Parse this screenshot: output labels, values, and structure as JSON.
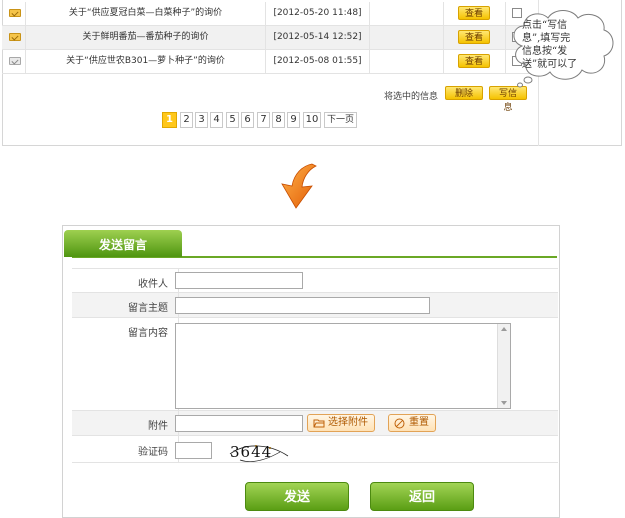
{
  "messages": [
    {
      "title": "关于“供应夏冠白菜—白菜种子”的询价",
      "date": "[2012-05-20 11:48]",
      "view": "查看",
      "icon": "envelope-closed"
    },
    {
      "title": "关于鲜明番茄—番茄种子的询价",
      "date": "[2012-05-14 12:52]",
      "view": "查看",
      "icon": "envelope-closed"
    },
    {
      "title": "关于“供应世农B301—萝卜种子”的询价",
      "date": "[2012-05-08 01:55]",
      "view": "查看",
      "icon": "envelope-open"
    }
  ],
  "actions": {
    "selected_label": "将选中的信息",
    "delete": "删除",
    "write": "写信息"
  },
  "pagination": {
    "pages": [
      "1",
      "2",
      "3",
      "4",
      "5",
      "6",
      "7",
      "8",
      "9",
      "10"
    ],
    "current": "1",
    "next": "下一页"
  },
  "callout": {
    "line1": "点击“写信",
    "line2": "息”,填写完",
    "line3": "信息按“发",
    "line4": "送”就可以了"
  },
  "form": {
    "tab": "发送留言",
    "recipient_label": "收件人",
    "subject_label": "留言主题",
    "content_label": "留言内容",
    "attachment_label": "附件",
    "choose_file": "选择附件",
    "reset": "重置",
    "captcha_label": "验证码",
    "captcha_text": "3644",
    "submit": "发送",
    "back": "返回"
  },
  "colors": {
    "accent_yellow": "#ffc71a",
    "accent_green": "#5a9e14",
    "arrow_orange": "#f07d1a"
  }
}
